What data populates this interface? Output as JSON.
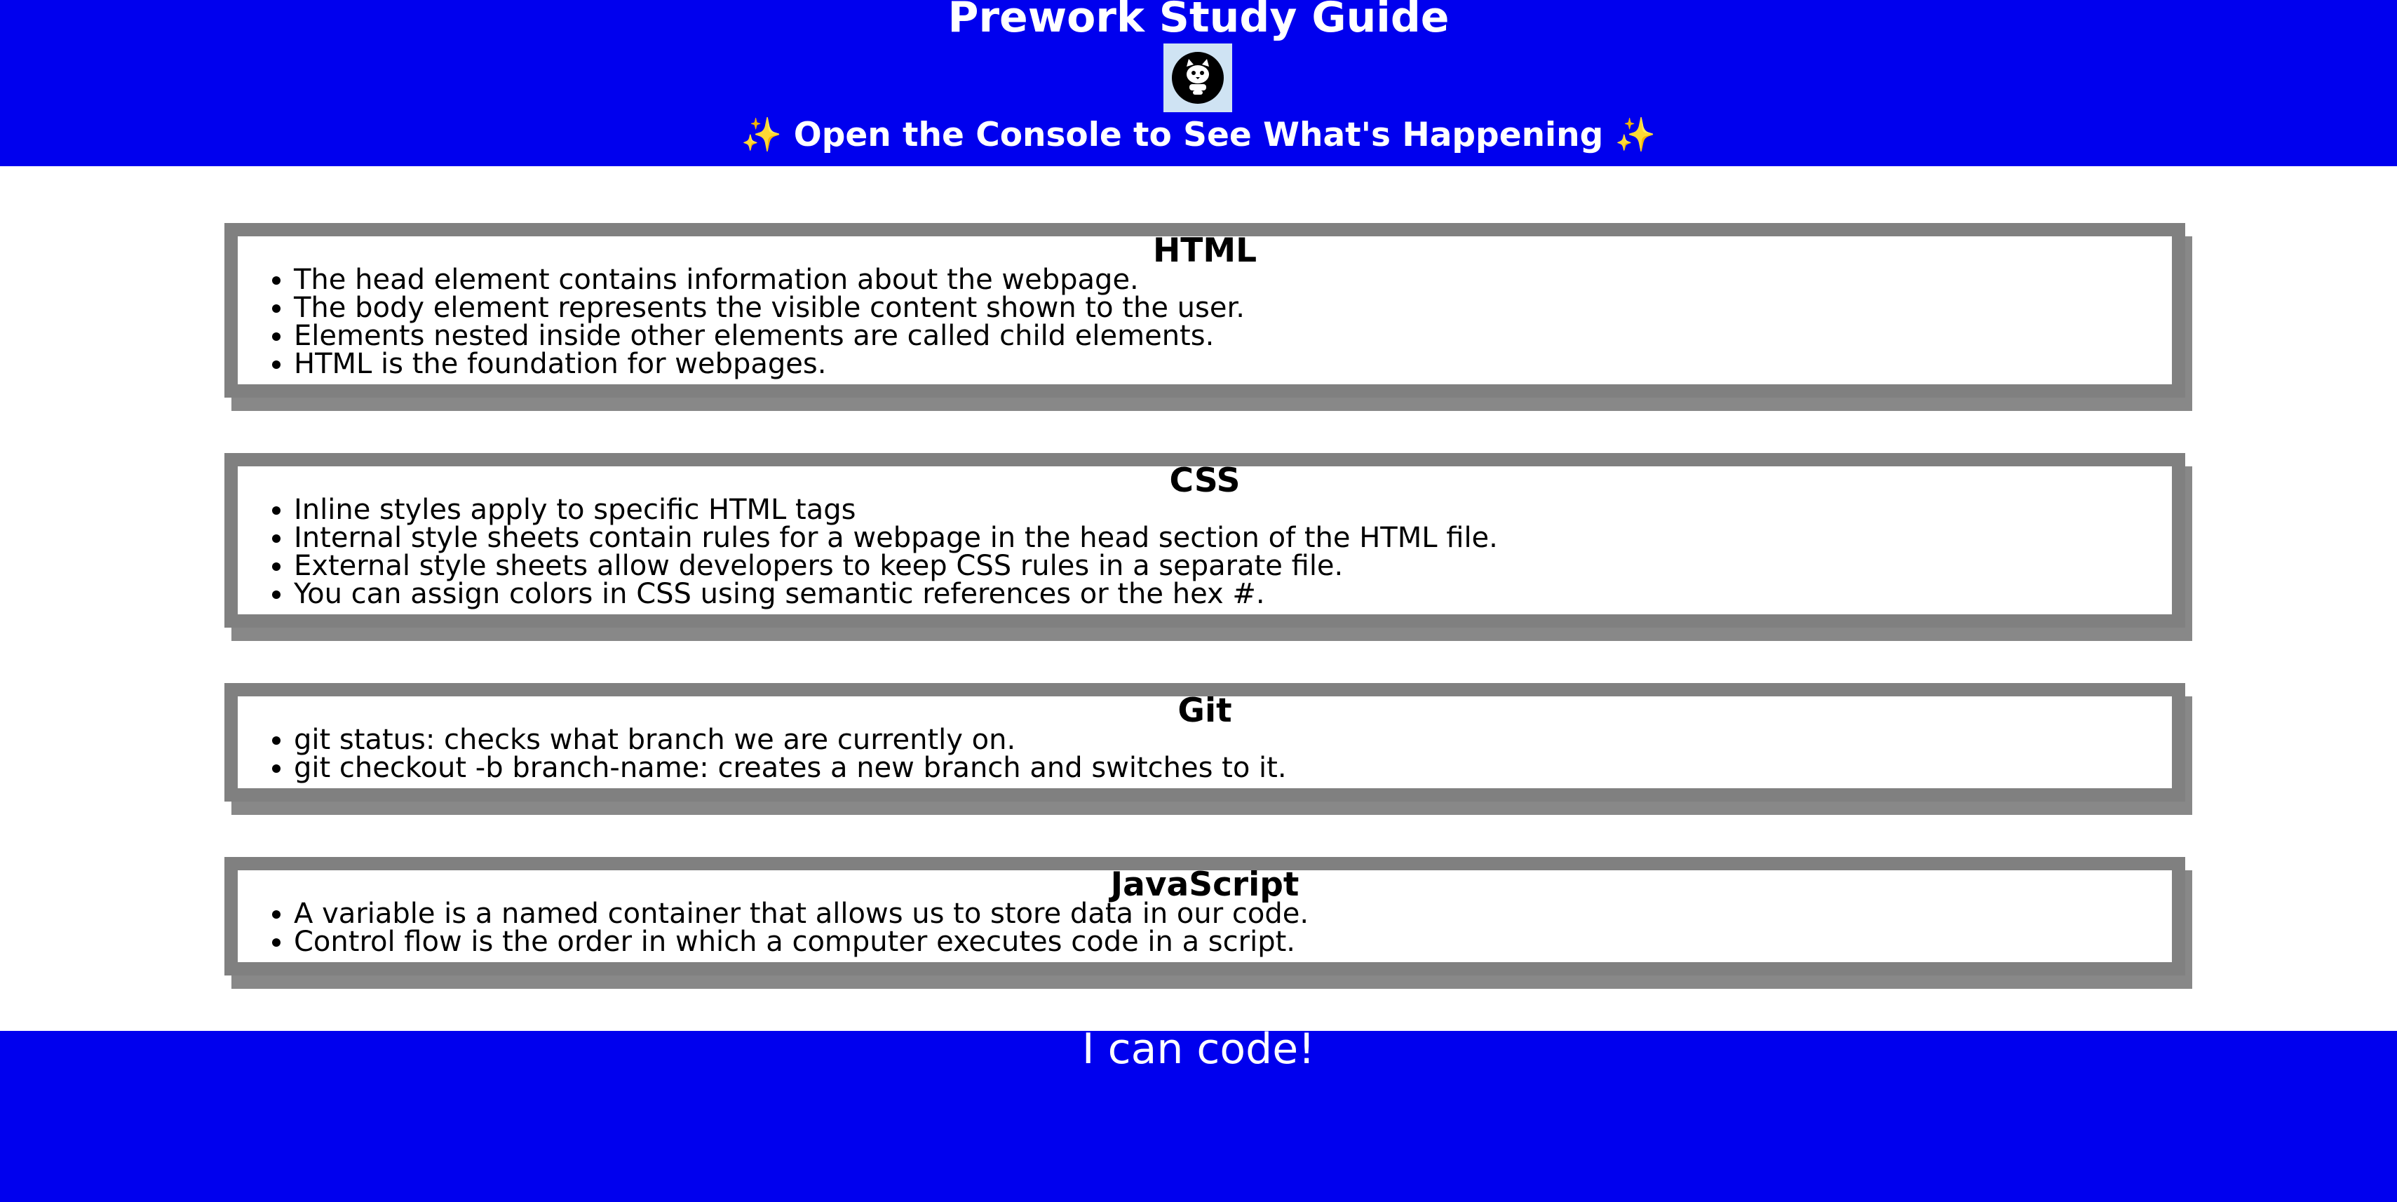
{
  "header": {
    "title": "Prework Study Guide",
    "logo_icon": "cat-logo-icon",
    "console_hint": "Open the Console to See What's Happening",
    "sparkle": "✨"
  },
  "cards": {
    "html": {
      "title": "HTML",
      "items": [
        "The head element contains information about the webpage.",
        "The body element represents the visible content shown to the user.",
        "Elements nested inside other elements are called child elements.",
        "HTML is the foundation for webpages."
      ]
    },
    "css": {
      "title": "CSS",
      "items": [
        "Inline styles apply to specific HTML tags",
        "Internal style sheets contain rules for a webpage in the head section of the HTML file.",
        "External style sheets allow developers to keep CSS rules in a separate file.",
        "You can assign colors in CSS using semantic references or the hex #."
      ]
    },
    "git": {
      "title": "Git",
      "items": [
        "git status: checks what branch we are currently on.",
        "git checkout -b branch-name: creates a new branch and switches to it."
      ]
    },
    "javascript": {
      "title": "JavaScript",
      "items": [
        "A variable is a named container that allows us to store data in our code.",
        "Control flow is the order in which a computer executes code in a script."
      ]
    }
  },
  "footer": {
    "text": "I can code!"
  },
  "colors": {
    "header_bg": "#0000ee",
    "footer_bg": "#0000ee",
    "card_border": "#808080",
    "card_shadow": "#888888",
    "logo_bg": "#cfe3f3"
  }
}
